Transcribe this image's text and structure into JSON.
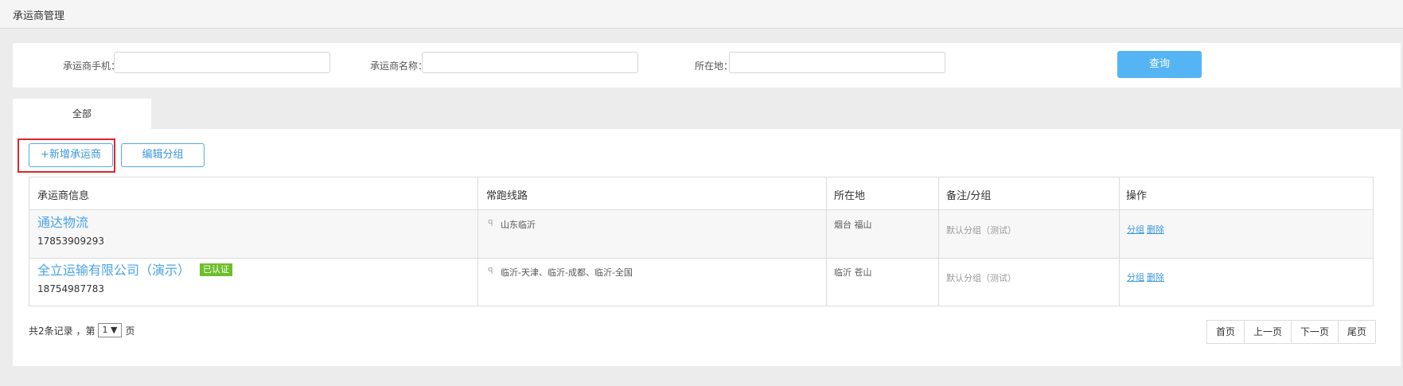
{
  "page": {
    "title": "承运商管理"
  },
  "filters": {
    "phone_label": "承运商手机：",
    "phone_value": "",
    "name_label": "承运商名称：",
    "name_value": "",
    "location_label": "所在地：",
    "location_value": "",
    "query_label": "查询"
  },
  "tabs": [
    {
      "label": "全部",
      "active": true
    }
  ],
  "toolbar": {
    "add_label": "+新增承运商",
    "edit_group_label": "编辑分组"
  },
  "table": {
    "columns": [
      "承运商信息",
      "常跑线路",
      "所在地",
      "备注/分组",
      "操作"
    ],
    "rows": [
      {
        "name": "通达物流",
        "phone": "17853909293",
        "certified": false,
        "route": "山东临沂",
        "location": "烟台 福山",
        "remark": "默认分组（测试）",
        "op_group": "分组",
        "op_delete": "删除"
      },
      {
        "name": "全立运输有限公司（演示）",
        "phone": "18754987783",
        "certified": true,
        "badge": "已认证",
        "route": "临沂-天津、临沂-成都、临沂-全国",
        "location": "临沂 苍山",
        "remark": "默认分组（测试）",
        "op_group": "分组",
        "op_delete": "删除"
      }
    ]
  },
  "pagination": {
    "prefix": "共2条记录 ，第",
    "current_page": "1",
    "dropdown_arrow": "▼",
    "suffix": "页",
    "first": "首页",
    "prev": "上一页",
    "next": "下一页",
    "last": "尾页"
  },
  "icons": {
    "route_icon": "flag-icon",
    "route_glyph": "ꟼ"
  },
  "colors": {
    "link": "#3b97dc",
    "primary": "#55b4f4",
    "badge": "#6cbf2a",
    "highlight": "#e0262b"
  }
}
